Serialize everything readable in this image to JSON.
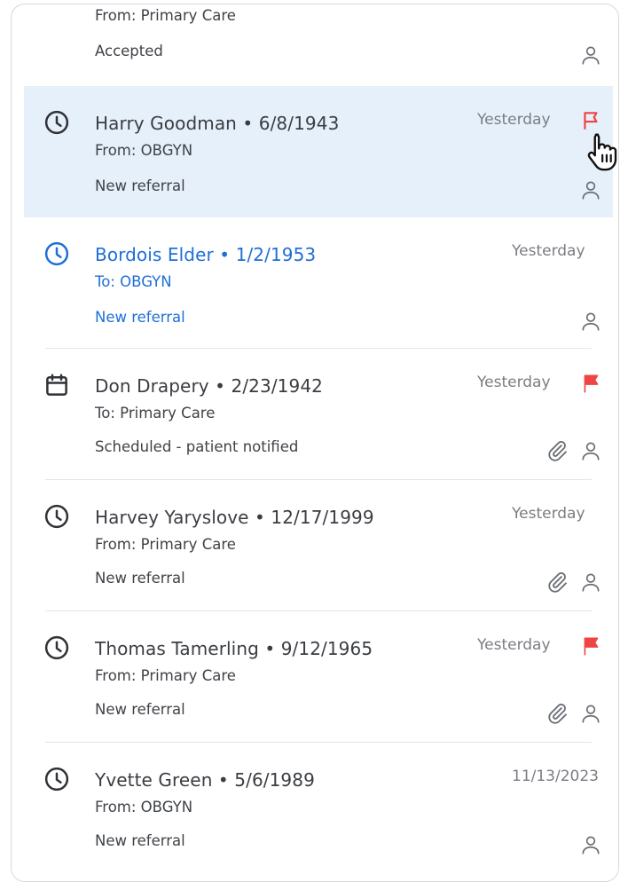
{
  "colors": {
    "selected_bg": "#e6f0fb",
    "active_text": "#1f6fd6",
    "flag_red": "#ef4444",
    "text_primary": "#3a3d42",
    "text_muted": "#7a7d82"
  },
  "referrals": [
    {
      "name_line": "",
      "source": "From: Primary Care",
      "status": "Accepted",
      "date": "",
      "icons": [
        "person-icon"
      ]
    },
    {
      "name_line": "Harry Goodman • 6/8/1943",
      "source": "From: OBGYN",
      "status": "New referral",
      "date": "Yesterday",
      "status_icon": "clock-icon",
      "flag": "outline",
      "selected": true,
      "icons": [
        "person-icon"
      ]
    },
    {
      "name_line": "Bordois Elder • 1/2/1953",
      "source": "To: OBGYN",
      "status": "New referral",
      "date": "Yesterday",
      "status_icon": "clock-icon",
      "active": true,
      "icons": [
        "person-icon"
      ]
    },
    {
      "name_line": "Don Drapery • 2/23/1942",
      "source": "To: Primary Care",
      "status": "Scheduled - patient notified",
      "date": "Yesterday",
      "status_icon": "calendar-icon",
      "flag": "filled",
      "icons": [
        "paperclip-icon",
        "person-icon"
      ]
    },
    {
      "name_line": "Harvey Yaryslove • 12/17/1999",
      "source": "From: Primary Care",
      "status": "New referral",
      "date": "Yesterday",
      "status_icon": "clock-icon",
      "icons": [
        "paperclip-icon",
        "person-icon"
      ]
    },
    {
      "name_line": "Thomas Tamerling • 9/12/1965",
      "source": "From: Primary Care",
      "status": "New referral",
      "date": "Yesterday",
      "status_icon": "clock-icon",
      "flag": "filled",
      "icons": [
        "paperclip-icon",
        "person-icon"
      ]
    },
    {
      "name_line": "Yvette Green • 5/6/1989",
      "source": "From: OBGYN",
      "status": "New referral",
      "date": "11/13/2023",
      "status_icon": "clock-icon",
      "icons": [
        "person-icon"
      ]
    }
  ]
}
